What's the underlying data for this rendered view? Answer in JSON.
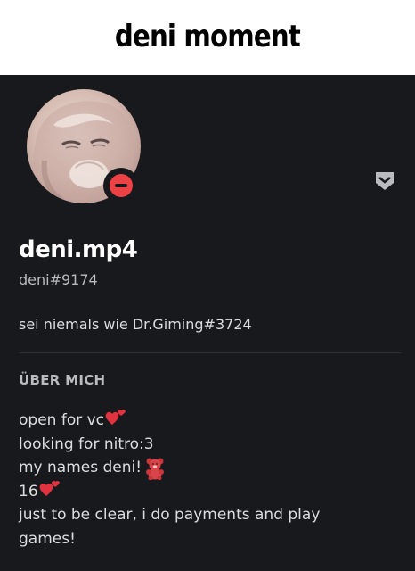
{
  "caption": {
    "text": "deni moment"
  },
  "profile": {
    "username": "deni.mp4",
    "tag": "deni#9174",
    "custom_status": "sei niemals wie Dr.Giming#3724",
    "status": "do-not-disturb",
    "status_color": "#ed4245",
    "about_title": "ÜBER MICH",
    "about_lines": [
      {
        "text": "open for vc",
        "emoji": "two-hearts-icon"
      },
      {
        "text": "looking for nitro:3",
        "emoji": ""
      },
      {
        "text": "my names deni!",
        "emoji": "teddy-bear-icon"
      },
      {
        "text": "16",
        "emoji": "two-hearts-icon"
      },
      {
        "text": "just to be clear, i do payments and play",
        "emoji": ""
      },
      {
        "text": "games!",
        "emoji": ""
      }
    ]
  },
  "colors": {
    "background": "#18191c",
    "caption_bg": "#ffffff",
    "text_primary": "#ffffff",
    "text_secondary": "#b9bbbe"
  }
}
